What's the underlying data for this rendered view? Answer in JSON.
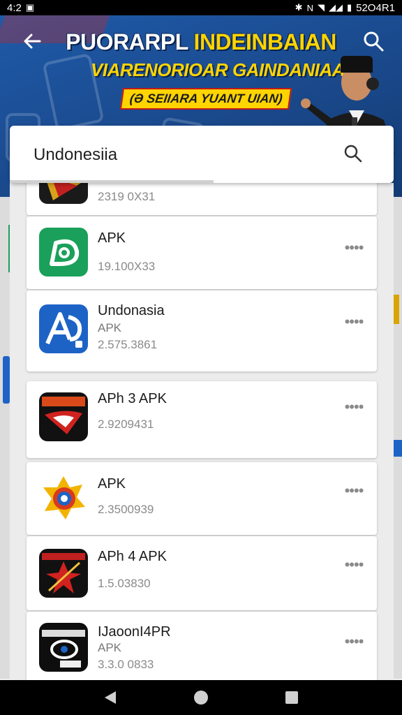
{
  "status_bar": {
    "time": "4:2",
    "right_text": "52O4R1"
  },
  "banner": {
    "title_line1_white": "PUORARPL",
    "title_line1_yellow": "INDEINBAIAN",
    "title_line2": "VIARENORIOAR GAINDANIAA",
    "title_line3": "(Ə SEIIARA YUANT UIAN)"
  },
  "search": {
    "query": "Undonesiia"
  },
  "list": {
    "items": [
      {
        "name": "",
        "sub": "",
        "size": "2319 0X31"
      },
      {
        "name": "APK",
        "sub": "",
        "size": "19.100X33"
      },
      {
        "name": "Undonasia",
        "sub": "APK",
        "size": "2.575.3861"
      },
      {
        "name": "APh 3 APK",
        "sub": "",
        "size": "2.9209431"
      },
      {
        "name": "APK",
        "sub": "",
        "size": "2.3500939"
      },
      {
        "name": "APh 4 APK",
        "sub": "",
        "size": "1.5.03830"
      },
      {
        "name": "IJaoonI4PR",
        "sub": "APK",
        "size": "3.3.0 0833"
      }
    ],
    "more_label": "••••"
  },
  "icons": {
    "item_icons": [
      "red-gold-game-icon",
      "green-d-icon",
      "blue-ap-icon",
      "rioarak-red-icon",
      "colorful-sun-icon",
      "red-star-icon",
      "black-app-icon"
    ],
    "status": [
      "notification-icon",
      "signal-icon",
      "wifi-icon",
      "battery-icon"
    ]
  },
  "colors": {
    "banner_blue": "#1b4c91",
    "accent_yellow": "#ffd400",
    "green": "#1aa05a",
    "blue": "#1d63c6"
  }
}
